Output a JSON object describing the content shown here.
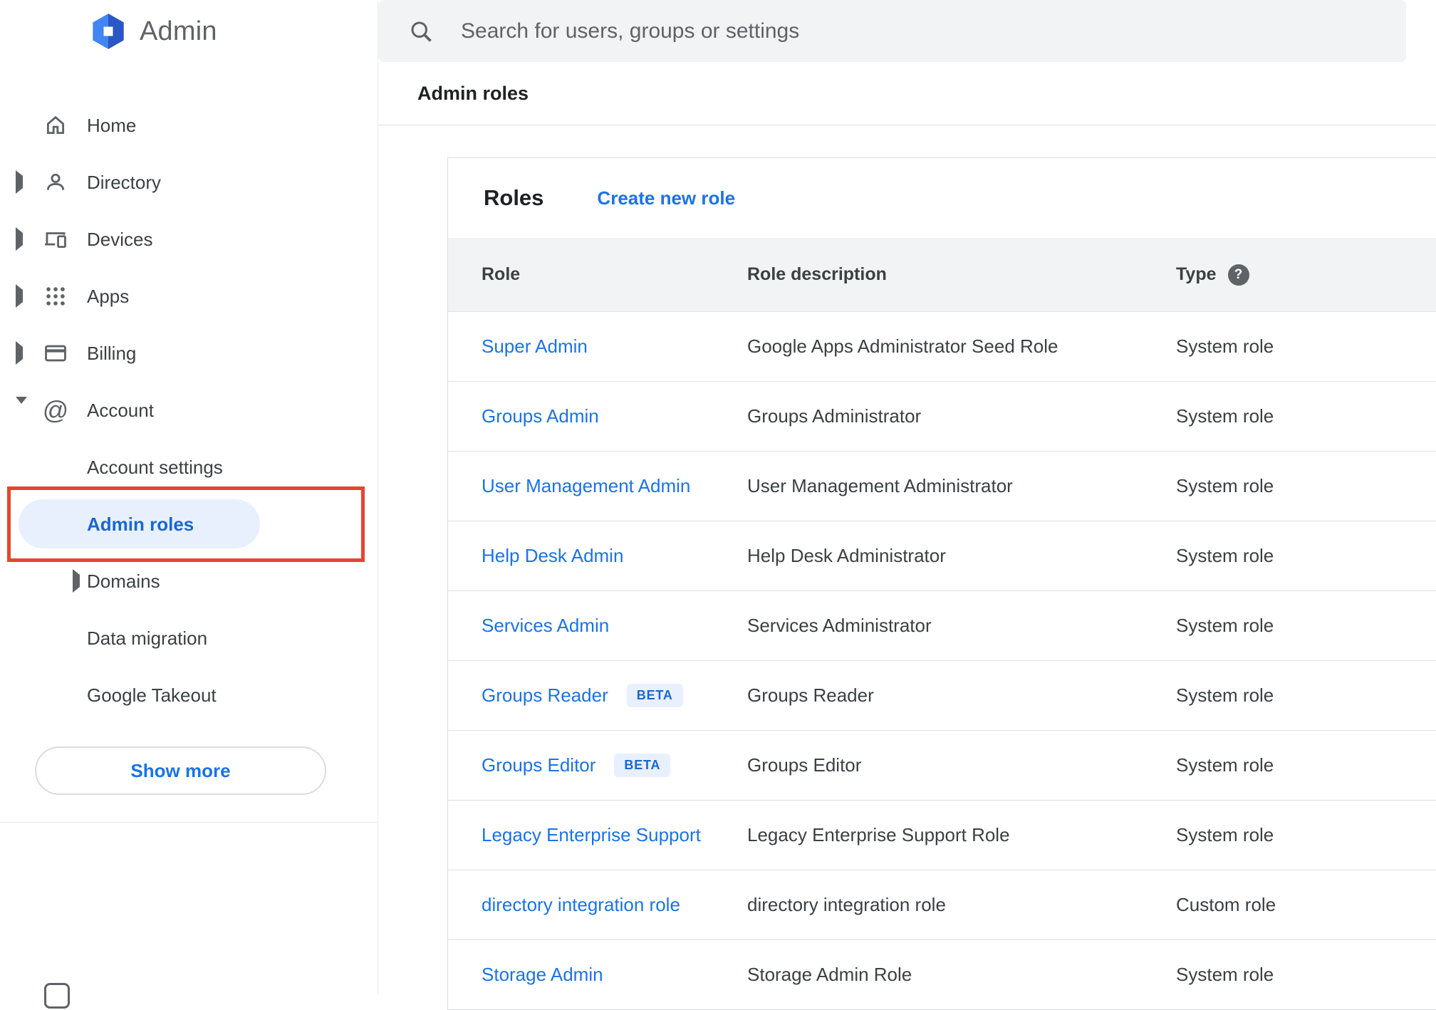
{
  "app": {
    "title": "Admin"
  },
  "search": {
    "placeholder": "Search for users, groups or settings"
  },
  "breadcrumb": "Admin roles",
  "sidebar": {
    "items": [
      {
        "label": "Home",
        "icon": "home-icon"
      },
      {
        "label": "Directory",
        "icon": "person-icon",
        "expandable": true
      },
      {
        "label": "Devices",
        "icon": "devices-icon",
        "expandable": true
      },
      {
        "label": "Apps",
        "icon": "apps-grid-icon",
        "expandable": true
      },
      {
        "label": "Billing",
        "icon": "credit-card-icon",
        "expandable": true
      },
      {
        "label": "Account",
        "icon": "at-icon",
        "expanded": true
      },
      {
        "label": "Account settings"
      },
      {
        "label": "Admin roles",
        "selected": true
      },
      {
        "label": "Domains",
        "expandable": true
      },
      {
        "label": "Data migration"
      },
      {
        "label": "Google Takeout"
      }
    ],
    "show_more": "Show more"
  },
  "roles": {
    "title": "Roles",
    "create_link": "Create new role",
    "columns": {
      "role": "Role",
      "description": "Role description",
      "type": "Type"
    },
    "help_glyph": "?",
    "beta_label": "BETA",
    "rows": [
      {
        "role": "Super Admin",
        "description": "Google Apps Administrator Seed Role",
        "type": "System role",
        "beta": false
      },
      {
        "role": "Groups Admin",
        "description": "Groups Administrator",
        "type": "System role",
        "beta": false
      },
      {
        "role": "User Management Admin",
        "description": "User Management Administrator",
        "type": "System role",
        "beta": false
      },
      {
        "role": "Help Desk Admin",
        "description": "Help Desk Administrator",
        "type": "System role",
        "beta": false
      },
      {
        "role": "Services Admin",
        "description": "Services Administrator",
        "type": "System role",
        "beta": false
      },
      {
        "role": "Groups Reader",
        "description": "Groups Reader",
        "type": "System role",
        "beta": true
      },
      {
        "role": "Groups Editor",
        "description": "Groups Editor",
        "type": "System role",
        "beta": true
      },
      {
        "role": "Legacy Enterprise Support",
        "description": "Legacy Enterprise Support Role",
        "type": "System role",
        "beta": false
      },
      {
        "role": "directory integration role",
        "description": "directory integration role",
        "type": "Custom role",
        "beta": false
      },
      {
        "role": "Storage Admin",
        "description": "Storage Admin Role",
        "type": "System role",
        "beta": false
      }
    ]
  },
  "colors": {
    "accent_blue": "#1a73e8",
    "selected_blue": "#1967d2",
    "selected_bg": "#e8f0fe",
    "header_bg": "#f1f3f4",
    "annotation_red": "#e8442e"
  }
}
